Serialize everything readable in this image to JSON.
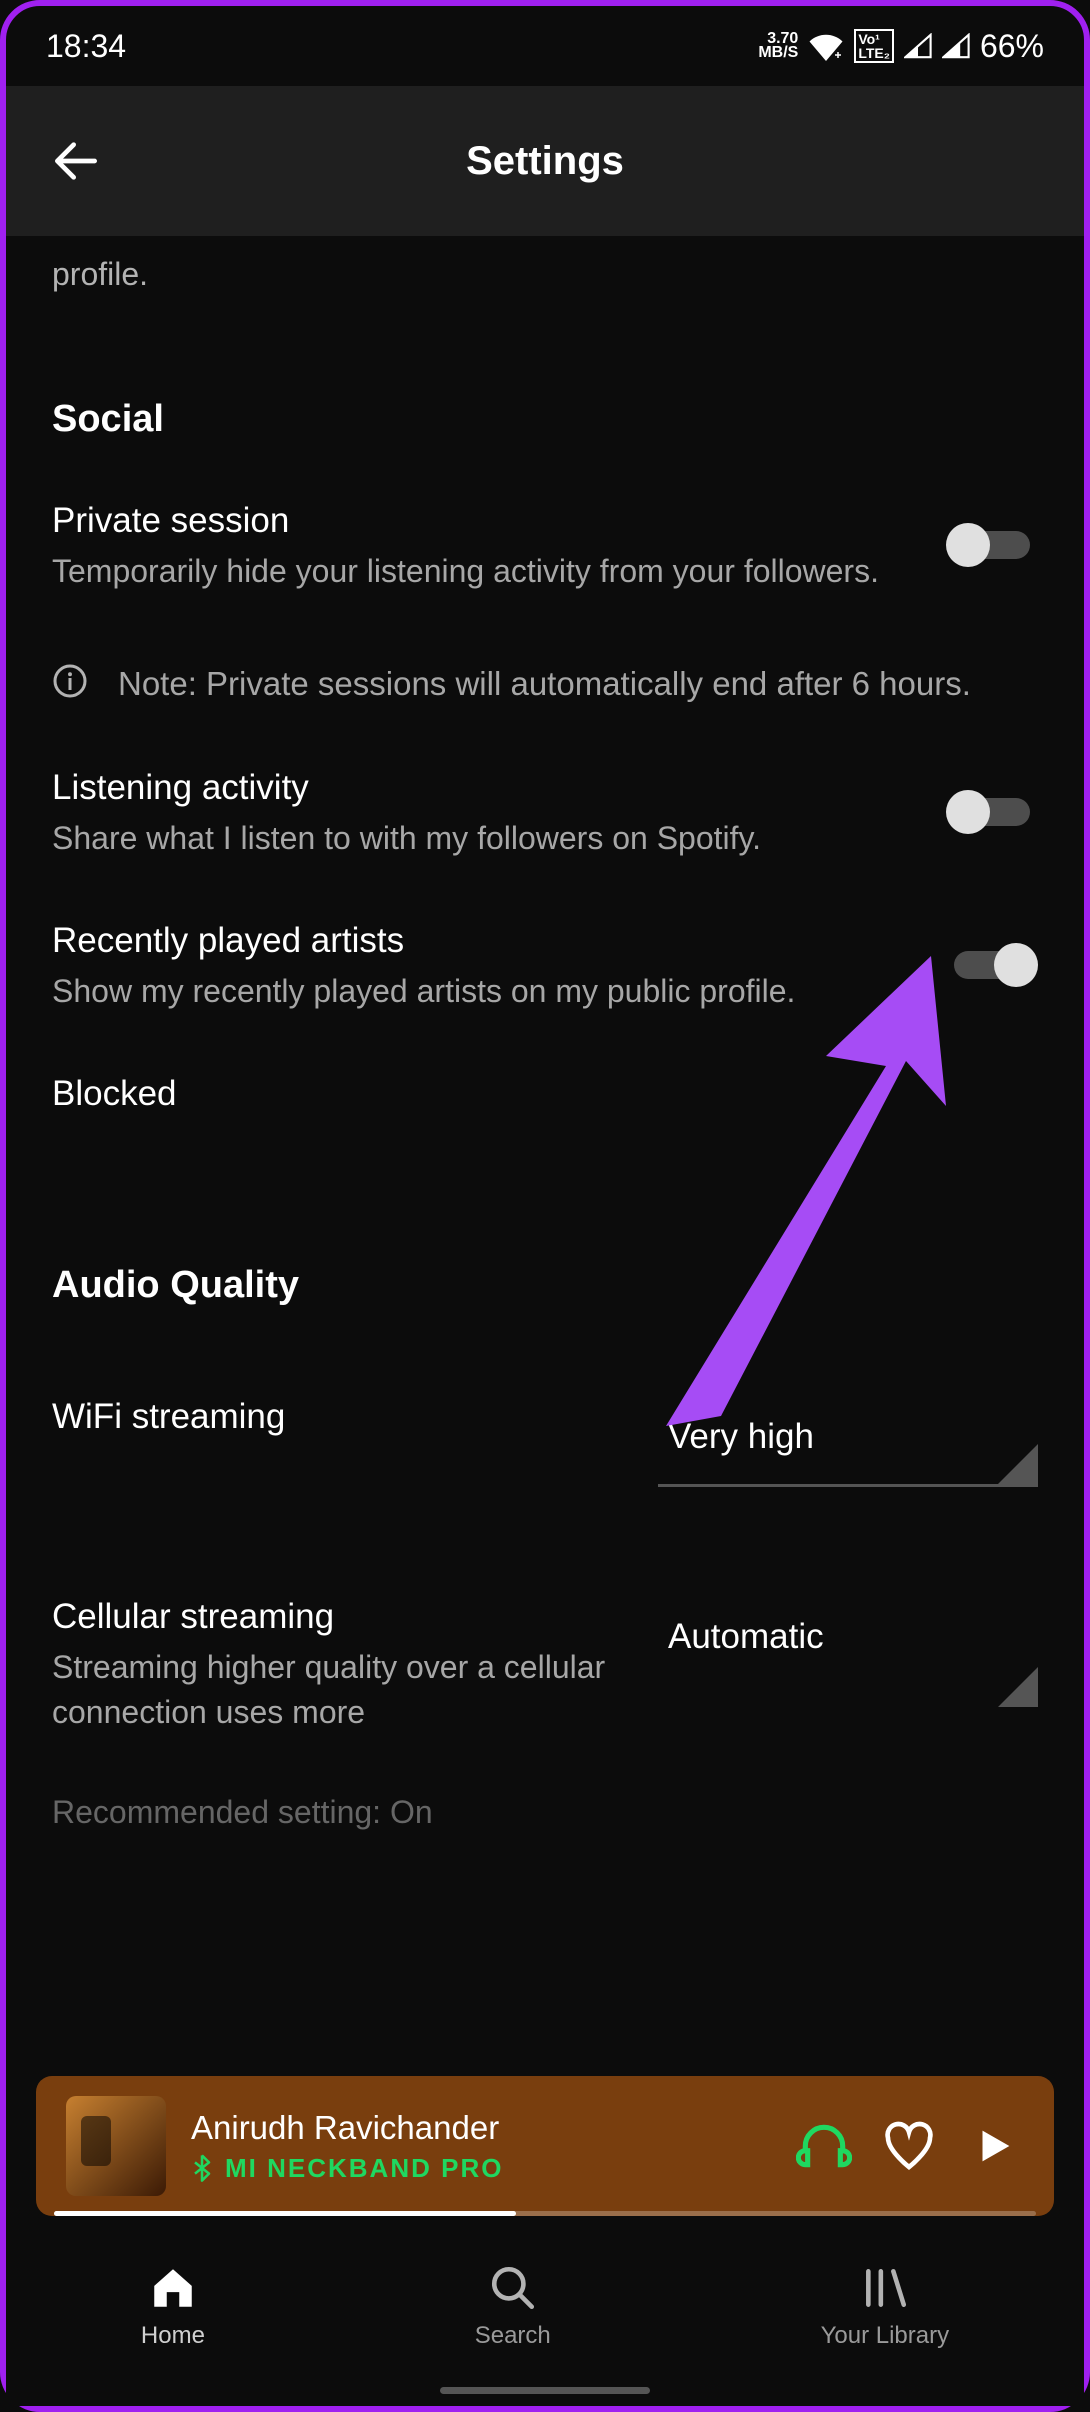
{
  "status": {
    "time": "18:34",
    "net_speed_top": "3.70",
    "net_speed_bot": "MB/S",
    "volte": "Vo LTE 1 2",
    "battery": "66%"
  },
  "header": {
    "title": "Settings"
  },
  "top_fragment": "profile.",
  "sections": {
    "social_title": "Social",
    "private_session": {
      "label": "Private session",
      "desc": "Temporarily hide your listening activity from your followers.",
      "on": false
    },
    "note": "Note: Private sessions will automatically end after 6 hours.",
    "listening_activity": {
      "label": "Listening activity",
      "desc": "Share what I listen to with my followers on Spotify.",
      "on": false
    },
    "recently_played": {
      "label": "Recently played artists",
      "desc": "Show my recently played artists on my public profile.",
      "on": false
    },
    "blocked": "Blocked",
    "audio_quality_title": "Audio Quality",
    "wifi_streaming": {
      "label": "WiFi streaming",
      "value": "Very high"
    },
    "cellular_streaming": {
      "label": "Cellular streaming",
      "desc": "Streaming higher quality over a cellular connection uses more",
      "value": "Automatic"
    },
    "recommended": "Recommended setting: On"
  },
  "now_playing": {
    "artist": "Anirudh Ravichander",
    "device": "MI NECKBAND PRO"
  },
  "nav": {
    "home": "Home",
    "search": "Search",
    "library": "Your Library"
  }
}
